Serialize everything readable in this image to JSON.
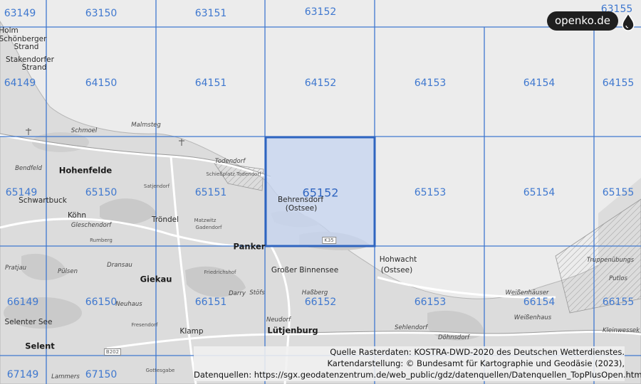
{
  "brand": {
    "logo_text": "openko.de"
  },
  "colors": {
    "grid_line": "#3f78cf",
    "selected_fill": "#c6d4f0",
    "selected_border": "#2f65c0",
    "land": "#dedede",
    "sea": "#ececec"
  },
  "grid": {
    "selected_tile": "65152",
    "tiles": [
      {
        "id": "t63149",
        "label": "63149"
      },
      {
        "id": "t63150",
        "label": "63150"
      },
      {
        "id": "t63151",
        "label": "63151"
      },
      {
        "id": "t63152",
        "label": "63152"
      },
      {
        "id": "t63155",
        "label": "63155"
      },
      {
        "id": "t64149",
        "label": "64149"
      },
      {
        "id": "t64150",
        "label": "64150"
      },
      {
        "id": "t64151",
        "label": "64151"
      },
      {
        "id": "t64152",
        "label": "64152"
      },
      {
        "id": "t64153",
        "label": "64153"
      },
      {
        "id": "t64154",
        "label": "64154"
      },
      {
        "id": "t64155",
        "label": "64155"
      },
      {
        "id": "t65149",
        "label": "65149"
      },
      {
        "id": "t65150",
        "label": "65150"
      },
      {
        "id": "t65151",
        "label": "65151"
      },
      {
        "id": "t65152",
        "label": "65152"
      },
      {
        "id": "t65153",
        "label": "65153"
      },
      {
        "id": "t65154",
        "label": "65154"
      },
      {
        "id": "t65155",
        "label": "65155"
      },
      {
        "id": "t66149",
        "label": "66149"
      },
      {
        "id": "t66150",
        "label": "66150"
      },
      {
        "id": "t66151",
        "label": "66151"
      },
      {
        "id": "t66152",
        "label": "66152"
      },
      {
        "id": "t66153",
        "label": "66153"
      },
      {
        "id": "t66154",
        "label": "66154"
      },
      {
        "id": "t66155",
        "label": "66155"
      },
      {
        "id": "t67149",
        "label": "67149"
      },
      {
        "id": "t67150",
        "label": "67150"
      }
    ]
  },
  "places": [
    {
      "id": "holm",
      "label": "Holm",
      "cls": "p-mid"
    },
    {
      "id": "schoenberger",
      "label": "Schönberger",
      "cls": "p-mid"
    },
    {
      "id": "strand1",
      "label": "Strand",
      "cls": "p-mid"
    },
    {
      "id": "stakendorfer",
      "label": "Stakendorfer",
      "cls": "p-mid"
    },
    {
      "id": "strand2",
      "label": "Strand",
      "cls": "p-mid"
    },
    {
      "id": "schmoel",
      "label": "Schmoel",
      "cls": "p-sm"
    },
    {
      "id": "malmsteg",
      "label": "Malmsteg",
      "cls": "p-sm"
    },
    {
      "id": "todendorf",
      "label": "Todendorf",
      "cls": "p-sm"
    },
    {
      "id": "schiessplatz",
      "label": "Schießplatz Todendorf",
      "cls": "p-xs"
    },
    {
      "id": "hohenfelde",
      "label": "Hohenfelde",
      "cls": "p-big"
    },
    {
      "id": "bendfeld",
      "label": "Bendfeld",
      "cls": "p-sm"
    },
    {
      "id": "satjendorf",
      "label": "Satjendorf",
      "cls": "p-xs"
    },
    {
      "id": "behrensdorf",
      "label": "Behrensdorf",
      "cls": "p-mid"
    },
    {
      "id": "ostsee1",
      "label": "(Ostsee)",
      "cls": "p-mid"
    },
    {
      "id": "schwartbuck",
      "label": "Schwartbuck",
      "cls": "p-mid"
    },
    {
      "id": "koehn",
      "label": "Köhn",
      "cls": "p-mid"
    },
    {
      "id": "gleschendorf",
      "label": "Gleschendorf",
      "cls": "p-sm"
    },
    {
      "id": "troendel",
      "label": "Tröndel",
      "cls": "p-mid"
    },
    {
      "id": "matzwitz",
      "label": "Matzwitz",
      "cls": "p-xs"
    },
    {
      "id": "gadendorf",
      "label": "Gadendorf",
      "cls": "p-xs"
    },
    {
      "id": "panker",
      "label": "Panker",
      "cls": "p-big"
    },
    {
      "id": "hohwacht",
      "label": "Hohwacht",
      "cls": "p-mid"
    },
    {
      "id": "ostsee2",
      "label": "(Ostsee)",
      "cls": "p-mid"
    },
    {
      "id": "grosser_binnensee",
      "label": "Großer Binnensee",
      "cls": "p-mid"
    },
    {
      "id": "truppenuebungs",
      "label": "Truppenübungs",
      "cls": "p-sm"
    },
    {
      "id": "putlos",
      "label": "Putlos",
      "cls": "p-sm"
    },
    {
      "id": "pratjau",
      "label": "Pratjau",
      "cls": "p-sm"
    },
    {
      "id": "puelsen",
      "label": "Pülsen",
      "cls": "p-sm"
    },
    {
      "id": "dransau",
      "label": "Dransau",
      "cls": "p-sm"
    },
    {
      "id": "giekau",
      "label": "Giekau",
      "cls": "p-big"
    },
    {
      "id": "friedrichshof",
      "label": "Friedrichshof",
      "cls": "p-xs"
    },
    {
      "id": "darry",
      "label": "Darry",
      "cls": "p-sm"
    },
    {
      "id": "stoefs",
      "label": "Stöfs",
      "cls": "p-sm"
    },
    {
      "id": "hassberg",
      "label": "Haßberg",
      "cls": "p-sm"
    },
    {
      "id": "weissenhaeuser",
      "label": "Weißenhäuser",
      "cls": "p-sm"
    },
    {
      "id": "neuhaus",
      "label": "Neuhaus",
      "cls": "p-sm"
    },
    {
      "id": "selenter_see",
      "label": "Selenter See",
      "cls": "p-mid"
    },
    {
      "id": "neudorf",
      "label": "Neudorf",
      "cls": "p-sm"
    },
    {
      "id": "luetjenburg",
      "label": "Lütjenburg",
      "cls": "p-big"
    },
    {
      "id": "sehlendorf",
      "label": "Sehlendorf",
      "cls": "p-sm"
    },
    {
      "id": "doehnsdorf",
      "label": "Döhnsdorf",
      "cls": "p-sm"
    },
    {
      "id": "weissenhaus",
      "label": "Weißenhaus",
      "cls": "p-sm"
    },
    {
      "id": "kleinwessek",
      "label": "Kleinwessek",
      "cls": "p-sm"
    },
    {
      "id": "fresendorf",
      "label": "Fresendorf",
      "cls": "p-xs"
    },
    {
      "id": "klamp",
      "label": "Klamp",
      "cls": "p-mid"
    },
    {
      "id": "selent",
      "label": "Selent",
      "cls": "p-big"
    },
    {
      "id": "lammers",
      "label": "Lammers",
      "cls": "p-sm"
    },
    {
      "id": "gottesgabe",
      "label": "Gottesgabe",
      "cls": "p-xs"
    },
    {
      "id": "ruhlberg",
      "label": "Rumberg",
      "cls": "p-xs"
    }
  ],
  "road_labels": [
    {
      "id": "k35",
      "label": "K35"
    },
    {
      "id": "b202",
      "label": "B202"
    }
  ],
  "attribution": {
    "line1": "Quelle Rasterdaten: KOSTRA-DWD-2020 des Deutschen Wetterdienstes.",
    "line2": "Kartendarstellung: © Bundesamt für Kartographie und Geodäsie (2023),",
    "line3": "Datenquellen: https://sgx.geodatenzentrum.de/web_public/gdz/datenquellen/Datenquellen_TopPlusOpen.html"
  }
}
